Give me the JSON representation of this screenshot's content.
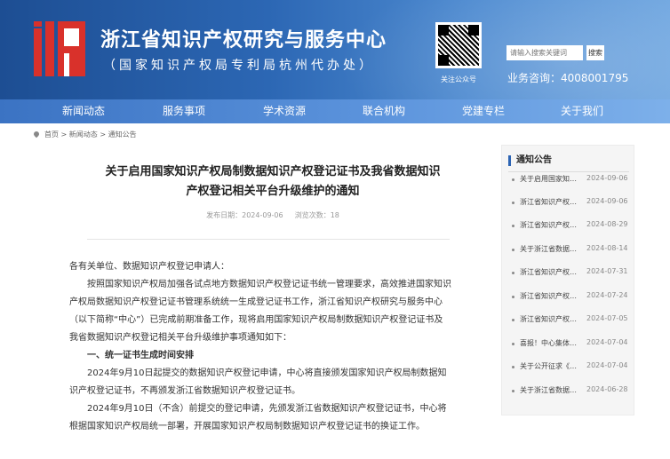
{
  "header": {
    "title": "浙江省知识产权研究与服务中心",
    "subtitle": "（国家知识产权局专利局杭州代办处）",
    "qr_label": "关注公众号",
    "search_placeholder": "请输入搜索关键词",
    "search_button": "搜索",
    "hotline": "业务咨询：4008001795"
  },
  "nav": {
    "items": [
      {
        "label": "新闻动态"
      },
      {
        "label": "服务事项"
      },
      {
        "label": "学术资源"
      },
      {
        "label": "联合机构"
      },
      {
        "label": "党建专栏"
      },
      {
        "label": "关于我们"
      }
    ]
  },
  "breadcrumb": {
    "home": "首页",
    "sep": " > ",
    "level1": "新闻动态",
    "level2": "通知公告"
  },
  "article": {
    "title_line1": "关于启用国家知识产权局制数据知识产权登记证书及我省数据知识",
    "title_line2": "产权登记相关平台升级维护的通知",
    "publish_label": "发布日期：",
    "publish_date": "2024-09-06",
    "views_label": "浏览次数：",
    "views": "18",
    "salutation": "各有关单位、数据知识产权登记申请人：",
    "para1": "按照国家知识产权局加强各试点地方数据知识产权登记证书统一管理要求，高效推进国家知识产权局数据知识产权登记证书管理系统统一生成登记证书工作，浙江省知识产权研究与服务中心（以下简称“中心”）已完成前期准备工作，现将启用国家知识产权局制数据知识产权登记证书及我省数据知识产权登记相关平台升级维护事项通知如下：",
    "heading1": "一、统一证书生成时间安排",
    "para2": "2024年9月10日起提交的数据知识产权登记申请，中心将直接颁发国家知识产权局制数据知识产权登记证书，不再颁发浙江省数据知识产权登记证书。",
    "para3": "2024年9月10日（不含）前提交的登记申请，先颁发浙江省数据知识产权登记证书，中心将根据国家知识产权局统一部署，开展国家知识产权局制数据知识产权登记证书的换证工作。"
  },
  "sidebar": {
    "title": "通知公告",
    "items": [
      {
        "title": "关于启用国家知…",
        "date": "2024-09-06"
      },
      {
        "title": "浙江省知识产权…",
        "date": "2024-09-06"
      },
      {
        "title": "浙江省知识产权…",
        "date": "2024-08-29"
      },
      {
        "title": "关于浙江省数据…",
        "date": "2024-08-14"
      },
      {
        "title": "浙江省知识产权…",
        "date": "2024-07-31"
      },
      {
        "title": "浙江省知识产权…",
        "date": "2024-07-24"
      },
      {
        "title": "浙江省知识产权…",
        "date": "2024-07-05"
      },
      {
        "title": "喜报！中心集体…",
        "date": "2024-07-04"
      },
      {
        "title": "关于公开征求《…",
        "date": "2024-07-04"
      },
      {
        "title": "关于浙江省数据…",
        "date": "2024-06-28"
      }
    ]
  }
}
